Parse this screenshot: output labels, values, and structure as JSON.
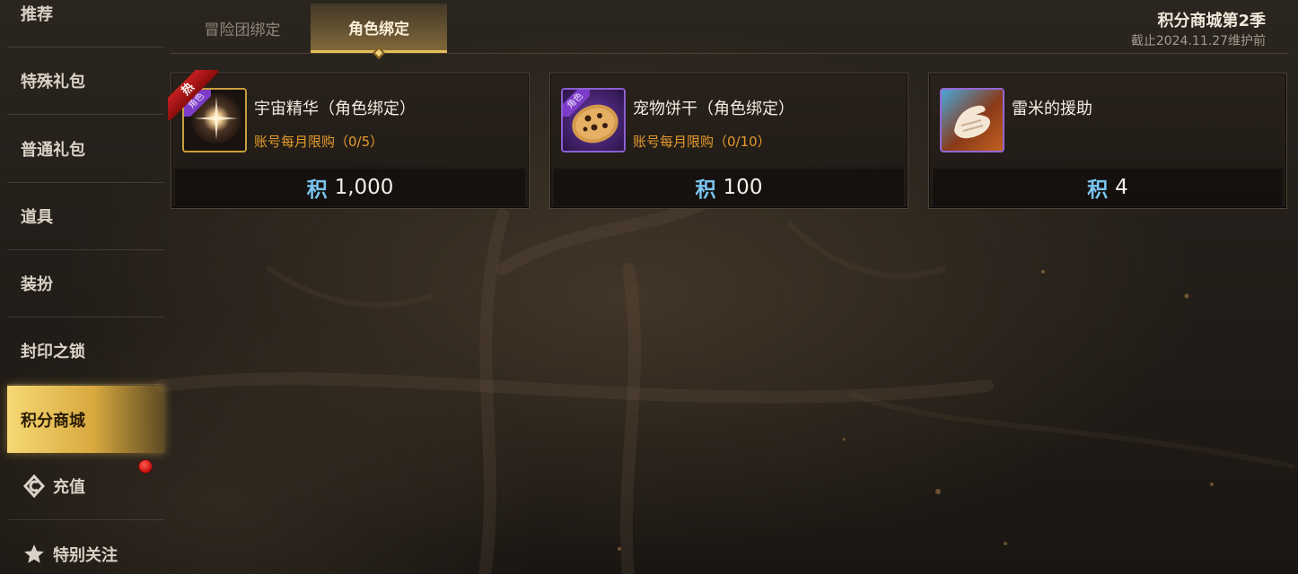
{
  "sidebar": {
    "items": [
      {
        "label": "推荐"
      },
      {
        "label": "特殊礼包"
      },
      {
        "label": "普通礼包"
      },
      {
        "label": "道具"
      },
      {
        "label": "装扮"
      },
      {
        "label": "封印之锁"
      },
      {
        "label": "积分商城",
        "active": true
      },
      {
        "label": "充值",
        "icon": "cera-coin-icon"
      },
      {
        "label": "特别关注",
        "icon": "star-icon"
      }
    ]
  },
  "tabs": [
    {
      "label": "冒险团绑定"
    },
    {
      "label": "角色绑定",
      "active": true
    }
  ],
  "season": {
    "title": "积分商城第2季",
    "subtitle": "截止2024.11.27维护前"
  },
  "products": [
    {
      "name": "宇宙精华（角色绑定）",
      "limit": "账号每月限购（0/5）",
      "price_symbol": "积",
      "price": "1,000",
      "hot_badge": "热",
      "role_tag": "角色"
    },
    {
      "name": "宠物饼干（角色绑定）",
      "limit": "账号每月限购（0/10）",
      "price_symbol": "积",
      "price": "100",
      "role_tag": "角色"
    },
    {
      "name": "雷米的援助",
      "limit": "",
      "price_symbol": "积",
      "price": "4"
    }
  ],
  "colors": {
    "active_tab_gold": "#e7be5c",
    "sidebar_active": "#f6d873",
    "limit_text": "#e59b2d",
    "point_symbol": "#79c4ef",
    "notification_dot": "#d91414"
  }
}
